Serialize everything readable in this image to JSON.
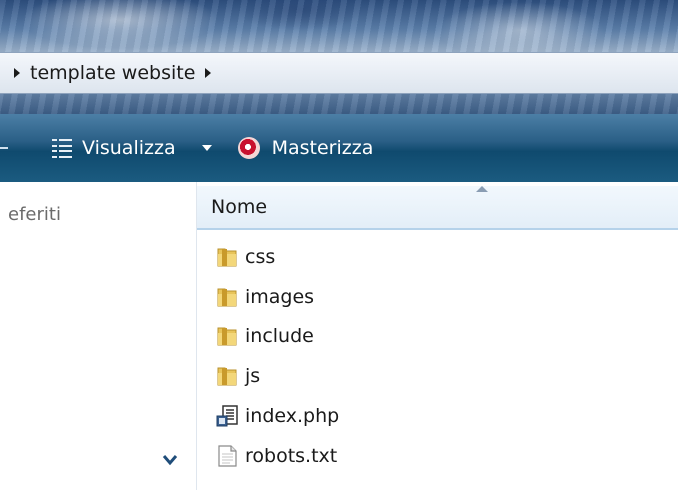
{
  "address": {
    "breadcrumb": "template website"
  },
  "toolbar": {
    "view_label": "Visualizza",
    "burn_label": "Masterizza"
  },
  "sidebar": {
    "partial_label": "eferiti"
  },
  "list": {
    "column_header": "Nome",
    "items": [
      {
        "name": "css",
        "icon": "folder-icon"
      },
      {
        "name": "images",
        "icon": "folder-icon"
      },
      {
        "name": "include",
        "icon": "folder-icon"
      },
      {
        "name": "js",
        "icon": "folder-icon"
      },
      {
        "name": "index.php",
        "icon": "php-file-icon"
      },
      {
        "name": "robots.txt",
        "icon": "text-file-icon"
      }
    ]
  },
  "colors": {
    "toolbar": "#1b5b80",
    "header_border": "#b5d2ea",
    "folder": "#e8c45a"
  }
}
